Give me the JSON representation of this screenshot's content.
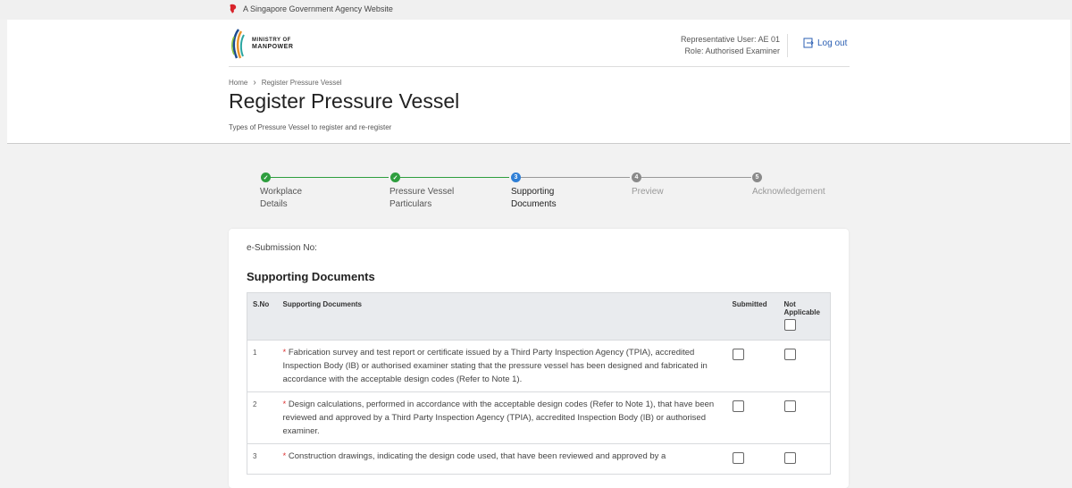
{
  "gov_banner": "A Singapore Government Agency Website",
  "logo": {
    "line1": "MINISTRY OF",
    "line2": "MANPOWER"
  },
  "user": {
    "rep": "Representative User: AE 01",
    "role": "Role: Authorised Examiner"
  },
  "logout": "Log out",
  "breadcrumb": {
    "home": "Home",
    "current": "Register Pressure Vessel"
  },
  "page_title": "Register Pressure Vessel",
  "page_subtitle": "Types of Pressure Vessel to register and re-register",
  "steps": [
    {
      "num": "1",
      "label1": "Workplace",
      "label2": "Details",
      "state": "done"
    },
    {
      "num": "2",
      "label1": "Pressure Vessel",
      "label2": "Particulars",
      "state": "done"
    },
    {
      "num": "3",
      "label1": "Supporting",
      "label2": "Documents",
      "state": "active"
    },
    {
      "num": "4",
      "label1": "Preview",
      "label2": "",
      "state": "pending"
    },
    {
      "num": "5",
      "label1": "Acknowledgement",
      "label2": "",
      "state": "pending"
    }
  ],
  "esubmission_label": "e-Submission No:",
  "section_title": "Supporting Documents",
  "table": {
    "headers": {
      "sno": "S.No",
      "doc": "Supporting Documents",
      "submitted": "Submitted",
      "na1": "Not",
      "na2": "Applicable"
    },
    "rows": [
      {
        "sno": "1",
        "text": "Fabrication survey and test report or certificate issued by a Third Party Inspection Agency (TPIA), accredited Inspection Body (IB) or authorised examiner stating that the pressure vessel has been designed and fabricated in accordance with the acceptable design codes (Refer to Note 1)."
      },
      {
        "sno": "2",
        "text": "Design calculations, performed in accordance with the acceptable design codes (Refer to Note 1), that have been reviewed and approved by a Third Party Inspection Agency (TPIA), accredited Inspection Body (IB) or authorised examiner."
      },
      {
        "sno": "3",
        "text": "Construction drawings, indicating the design code used, that have been reviewed and approved by a"
      }
    ]
  },
  "colors": {
    "done": "#2e9e3e",
    "active": "#2f7fd6",
    "pending": "#8a8a8a"
  }
}
